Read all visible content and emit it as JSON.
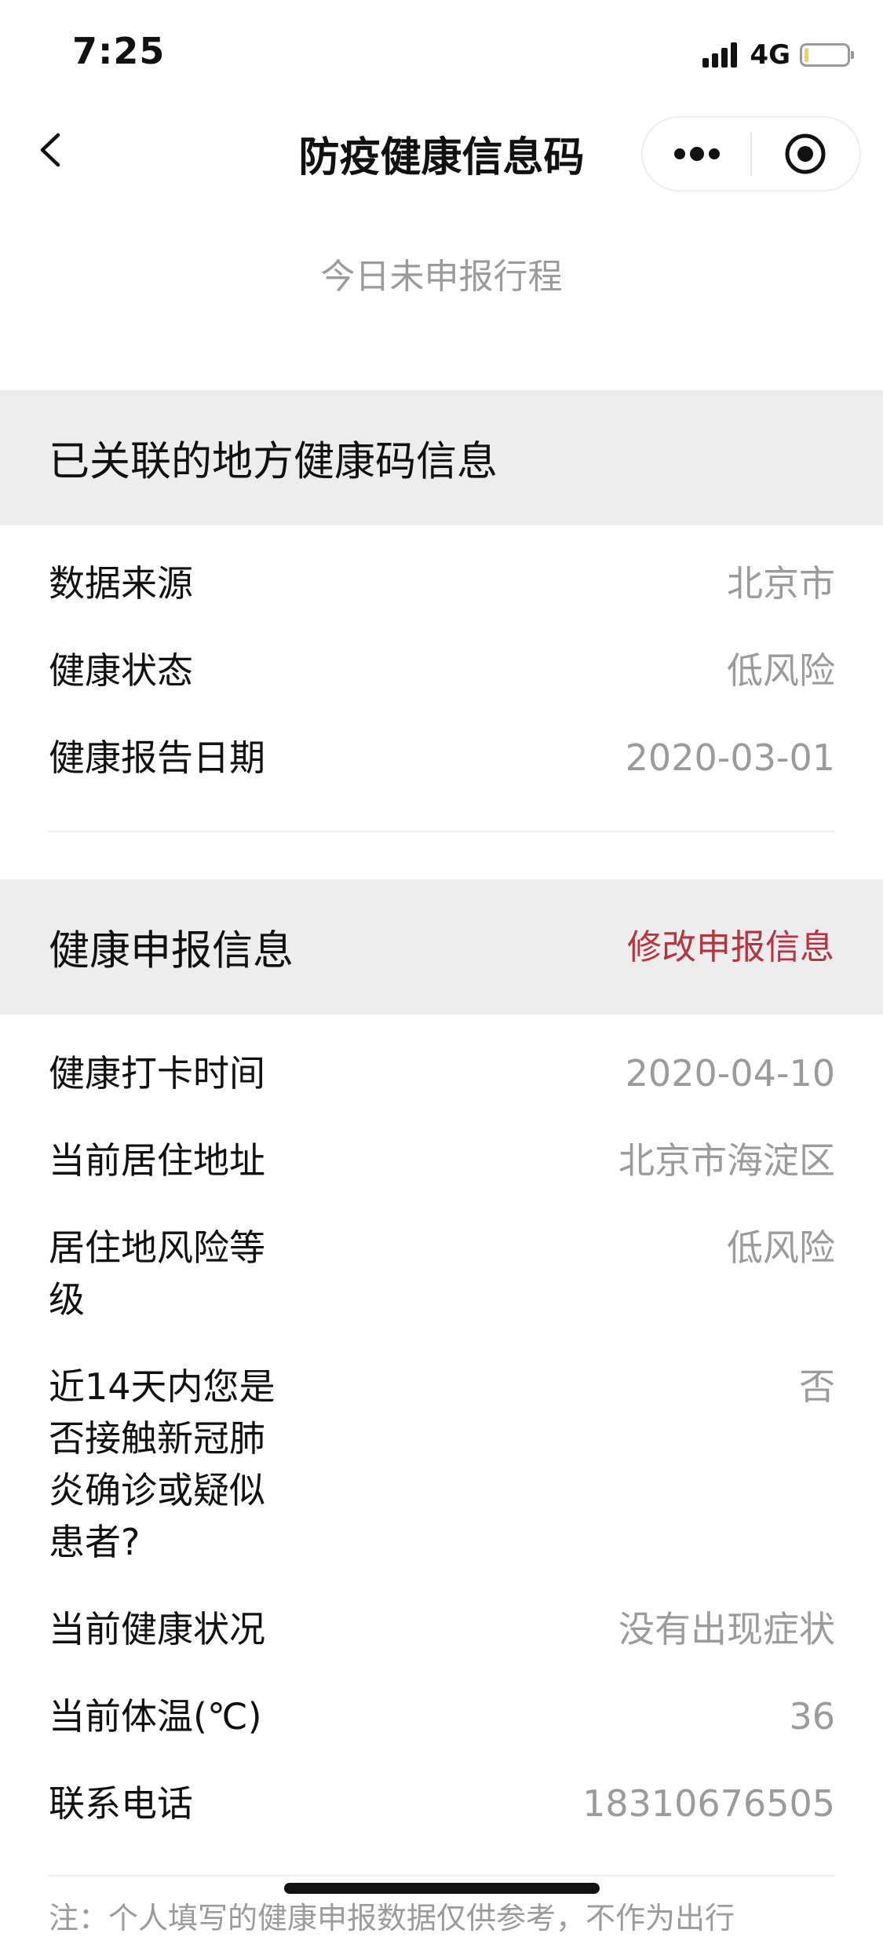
{
  "status_bar": {
    "time": "7:25",
    "network": "4G",
    "battery_level": 0.1,
    "battery_color": "#f5d04a"
  },
  "nav": {
    "title": "防疫健康信息码",
    "back_icon": "chevron-left-icon",
    "more_icon": "more-dots-icon",
    "close_icon": "target-close-icon"
  },
  "notice": "今日未申报行程",
  "linked_section": {
    "title": "已关联的地方健康码信息",
    "rows": [
      {
        "label": "数据来源",
        "value": "北京市"
      },
      {
        "label": "健康状态",
        "value": "低风险"
      },
      {
        "label": "健康报告日期",
        "value": "2020-03-01"
      }
    ]
  },
  "declare_section": {
    "title": "健康申报信息",
    "action": "修改申报信息",
    "action_color": "#b8323f",
    "rows": [
      {
        "label": "健康打卡时间",
        "value": "2020-04-10"
      },
      {
        "label": "当前居住地址",
        "value": "北京市海淀区"
      },
      {
        "label": "居住地风险等级",
        "value": "低风险"
      },
      {
        "label": "近14天内您是否接触新冠肺炎确诊或疑似患者?",
        "value": "否"
      },
      {
        "label": "当前健康状况",
        "value": "没有出现症状"
      },
      {
        "label": "当前体温(℃)",
        "value": "36"
      },
      {
        "label": "联系电话",
        "value": "18310676505"
      }
    ]
  },
  "footnote": "注：个人填写的健康申报数据仅供参考，不作为出行"
}
